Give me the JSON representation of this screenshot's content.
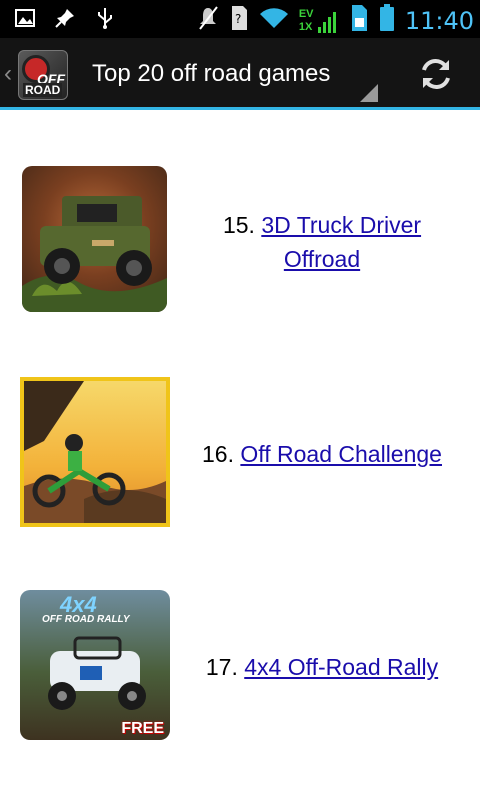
{
  "status_bar": {
    "time": "11:40",
    "ev_label": "EV",
    "onex_label": "1X"
  },
  "action_bar": {
    "title": "Top 20 off road games",
    "logo_text_top": "OFF",
    "logo_text_bottom": "ROAD"
  },
  "items": [
    {
      "number": "15.",
      "title_line1": "3D Truck Driver",
      "title_line2": "Offroad"
    },
    {
      "number": "16.",
      "title": "Off Road Challenge"
    },
    {
      "number": "17.",
      "title": "4x4 Off-Road Rally",
      "thumb_banner": "4x4",
      "thumb_subbanner": "OFF ROAD RALLY",
      "thumb_badge": "FREE"
    }
  ],
  "colors": {
    "accent": "#33b5e5",
    "link": "#1a0dab",
    "time": "#4fc3f7"
  }
}
